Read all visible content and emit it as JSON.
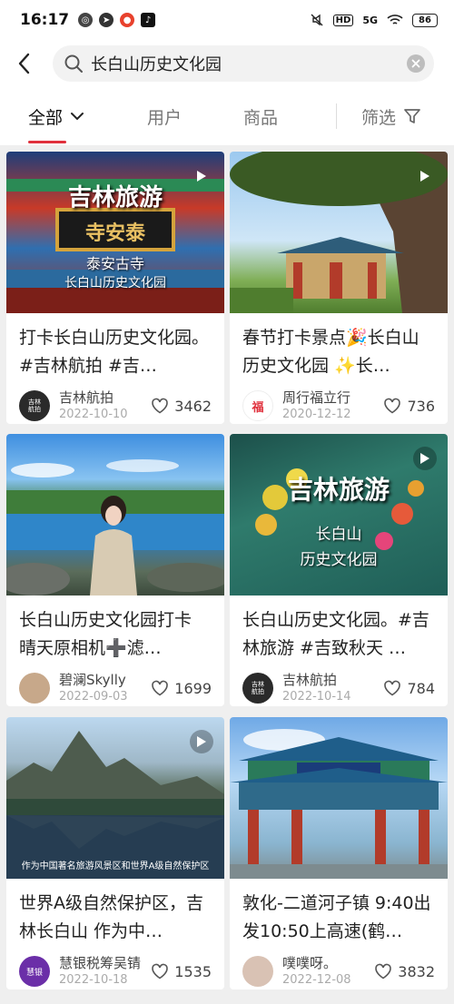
{
  "status": {
    "time": "16:17",
    "network": "5G",
    "battery": "86",
    "hd": "HD"
  },
  "search": {
    "query": "长白山历史文化园"
  },
  "tabs": {
    "all": "全部",
    "users": "用户",
    "goods": "商品",
    "filter": "筛选"
  },
  "cards": [
    {
      "overlay": [
        "吉林旅游",
        "泰安古寺",
        "长白山历史文化园"
      ],
      "plaque": "寺安泰",
      "title": "打卡长白山历史文化园。#吉林航拍 #吉…",
      "user": "吉林航拍",
      "date": "2022-10-10",
      "likes": "3462",
      "avatar_text": "吉林航拍"
    },
    {
      "title": "春节打卡景点🎉长白山历史文化园 ✨长…",
      "user": "周行福立行",
      "date": "2020-12-12",
      "likes": "736",
      "avatar_text": "福"
    },
    {
      "title": "长白山历史文化园打卡 晴天原相机➕滤…",
      "user": "碧澜Skylly",
      "date": "2022-09-03",
      "likes": "1699",
      "avatar_text": ""
    },
    {
      "overlay": [
        "吉林旅游",
        "长白山",
        "历史文化园"
      ],
      "title": "长白山历史文化园。#吉林旅游 #吉致秋天 …",
      "user": "吉林航拍",
      "date": "2022-10-14",
      "likes": "784",
      "avatar_text": "吉林航拍"
    },
    {
      "caption": "作为中国著名旅游风景区和世界A级自然保护区",
      "title": "世界A级自然保护区，吉林长白山 作为中…",
      "user": "慧银税筹吴锖",
      "date": "2022-10-18",
      "likes": "1535",
      "avatar_text": "慧银"
    },
    {
      "title": "敦化-二道河子镇 9:40出发10:50上高速(鹤…",
      "user": "噗噗呀。",
      "date": "2022-12-08",
      "likes": "3832",
      "avatar_text": ""
    }
  ]
}
